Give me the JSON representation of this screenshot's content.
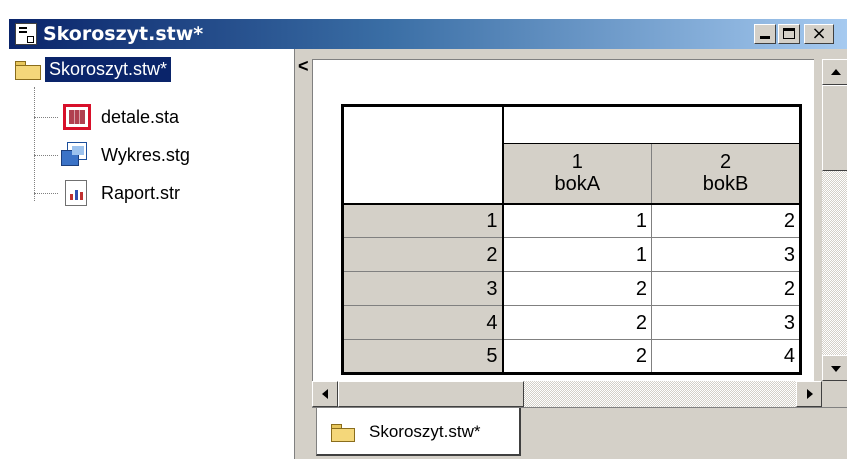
{
  "window": {
    "title": "Skoroszyt.stw*",
    "buttons": {
      "minimize_icon": "minimize-icon",
      "maximize_icon": "maximize-icon",
      "close_glyph": "×"
    }
  },
  "tree": {
    "root": {
      "label": "Skoroszyt.stw*",
      "icon": "folder-open-icon"
    },
    "items": [
      {
        "label": "detale.sta",
        "icon": "spreadsheet-icon"
      },
      {
        "label": "Wykres.stg",
        "icon": "graph-icon"
      },
      {
        "label": "Raport.str",
        "icon": "report-icon"
      }
    ]
  },
  "splitter": {
    "glyph": "<"
  },
  "spreadsheet": {
    "columns": [
      {
        "number": "1",
        "name": "bokA"
      },
      {
        "number": "2",
        "name": "bokB"
      }
    ],
    "rows": [
      {
        "label": "1",
        "values": [
          "1",
          "2"
        ]
      },
      {
        "label": "2",
        "values": [
          "1",
          "3"
        ]
      },
      {
        "label": "3",
        "values": [
          "2",
          "2"
        ]
      },
      {
        "label": "4",
        "values": [
          "2",
          "3"
        ]
      },
      {
        "label": "5",
        "values": [
          "2",
          "4"
        ]
      }
    ]
  },
  "tabs": [
    {
      "label": "Skoroszyt.stw*",
      "icon": "folder-icon"
    }
  ],
  "colors": {
    "title_active": "#0a246a",
    "selection": "#0a246a",
    "face": "#d4d0c8",
    "highlight_red": "#d8102a"
  }
}
